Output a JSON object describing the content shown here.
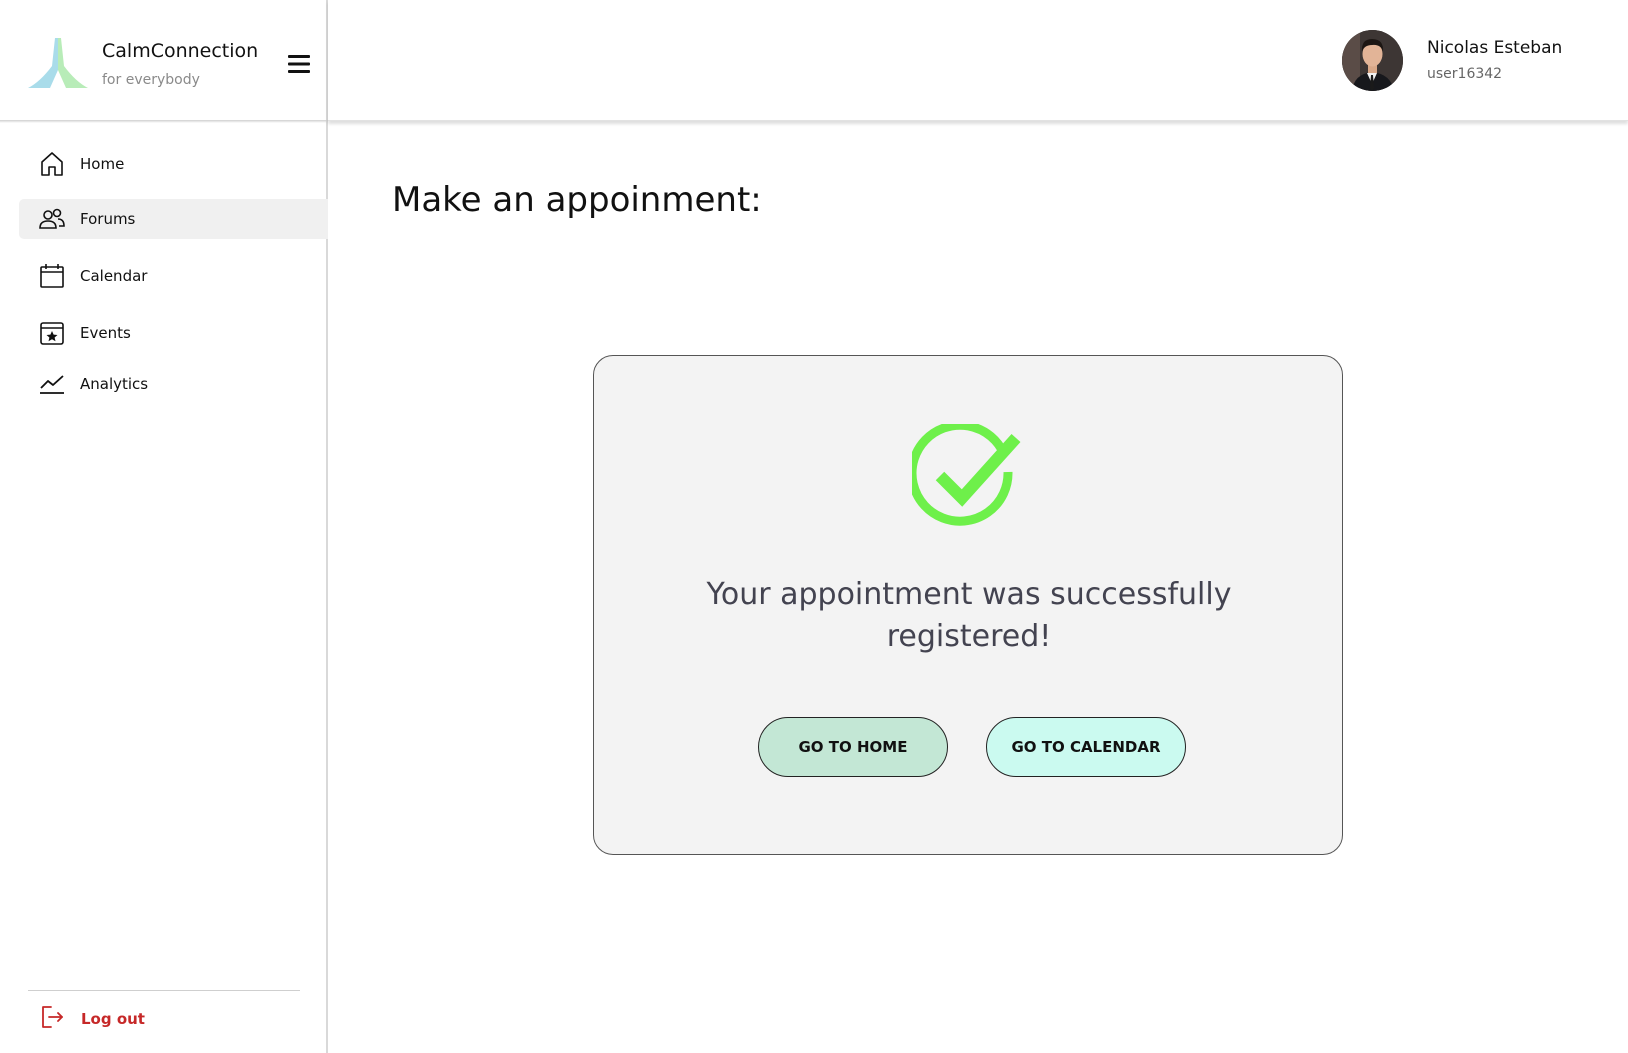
{
  "brand": {
    "name": "CalmConnection",
    "tagline": "for everybody"
  },
  "user": {
    "name": "Nicolas Esteban",
    "id": "user16342"
  },
  "sidebar": {
    "items": [
      {
        "label": "Home",
        "icon": "home-icon",
        "active": false
      },
      {
        "label": "Forums",
        "icon": "users-icon",
        "active": true
      },
      {
        "label": "Calendar",
        "icon": "calendar-icon",
        "active": false
      },
      {
        "label": "Events",
        "icon": "star-calendar-icon",
        "active": false
      },
      {
        "label": "Analytics",
        "icon": "analytics-icon",
        "active": false
      }
    ],
    "logout_label": "Log out"
  },
  "main": {
    "title": "Make an appoinment:",
    "success_line1": "Your appointment was successfully",
    "success_line2": "registered!",
    "home_button": "GO TO HOME",
    "calendar_button": "GO TO CALENDAR"
  },
  "colors": {
    "success_green": "#6ef04a",
    "logout_red": "#c62828",
    "home_button_bg": "#c3e7d5",
    "calendar_button_bg": "#cbfaf0",
    "card_bg": "#f3f3f3"
  }
}
